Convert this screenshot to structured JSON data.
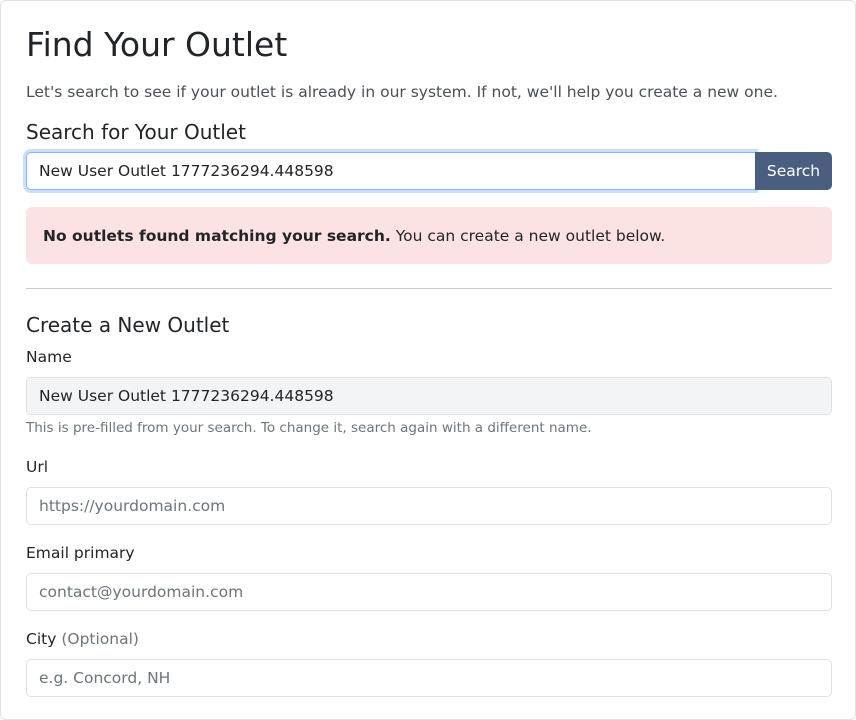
{
  "page": {
    "title": "Find Your Outlet",
    "intro": "Let's search to see if your outlet is already in our system. If not, we'll help you create a new one."
  },
  "search": {
    "heading": "Search for Your Outlet",
    "value": "New User Outlet 1777236294.448598",
    "button_label": "Search"
  },
  "alert": {
    "bold_text": "No outlets found matching your search.",
    "text": " You can create a new outlet below."
  },
  "create": {
    "heading": "Create a New Outlet",
    "name": {
      "label": "Name",
      "value": "New User Outlet 1777236294.448598",
      "help": "This is pre-filled from your search. To change it, search again with a different name."
    },
    "url": {
      "label": "Url",
      "placeholder": "https://yourdomain.com"
    },
    "email": {
      "label": "Email primary",
      "placeholder": "contact@yourdomain.com"
    },
    "city": {
      "label": "City",
      "optional": "(Optional)",
      "placeholder": "e.g. Concord, NH"
    }
  },
  "colors": {
    "search_button": "#4a5f7f",
    "alert_background": "#fde2e4",
    "focus_border": "#86b7fe"
  }
}
